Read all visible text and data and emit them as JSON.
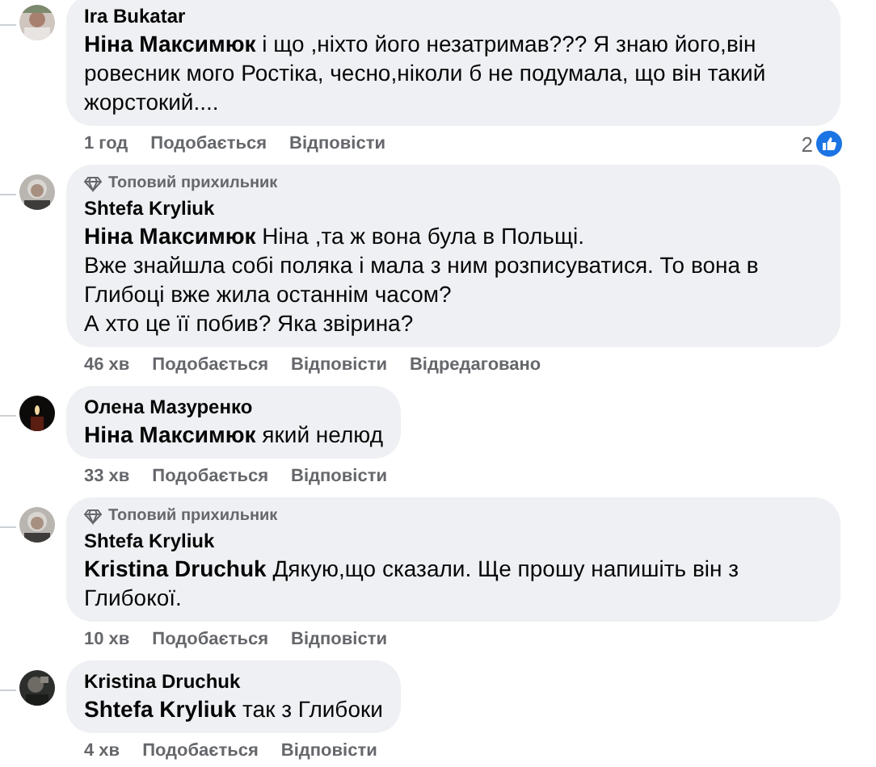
{
  "comments": [
    {
      "author": "Ira Bukatar",
      "text": "**Ніна Максимюк** і що ,ніхто його незатримав??? Я знаю його,він ровесник мого Ростіка, чесно,ніколи б не подумала, що він такий жорстокий....",
      "time": "1 год",
      "like": "Подобається",
      "reply": "Відповісти",
      "reactions": "2"
    },
    {
      "badge": "Топовий прихильник",
      "author": "Shtefa Kryliuk",
      "text": "**Ніна Максимюк** Ніна ,та ж вона була в Польщі.\nВже знайшла собі поляка і мала з ним розписуватися. То вона в Глибоці вже жила останнім часом?\nА хто це її побив? Яка звірина?",
      "time": "46 хв",
      "like": "Подобається",
      "reply": "Відповісти",
      "edited": "Відредаговано"
    },
    {
      "author": "Олена Мазуренко",
      "text": "**Ніна Максимюк** який нелюд",
      "time": "33 хв",
      "like": "Подобається",
      "reply": "Відповісти"
    },
    {
      "badge": "Топовий прихильник",
      "author": "Shtefa Kryliuk",
      "text": "**Kristina Druchuk** Дякую,що сказали. Ще прошу напишіть він з Глибокої.",
      "time": "10 хв",
      "like": "Подобається",
      "reply": "Відповісти"
    },
    {
      "author": "Kristina Druchuk",
      "text": "**Shtefa Kryliuk** так з Глибоки",
      "time": "4 хв",
      "like": "Подобається",
      "reply": "Відповісти"
    }
  ]
}
